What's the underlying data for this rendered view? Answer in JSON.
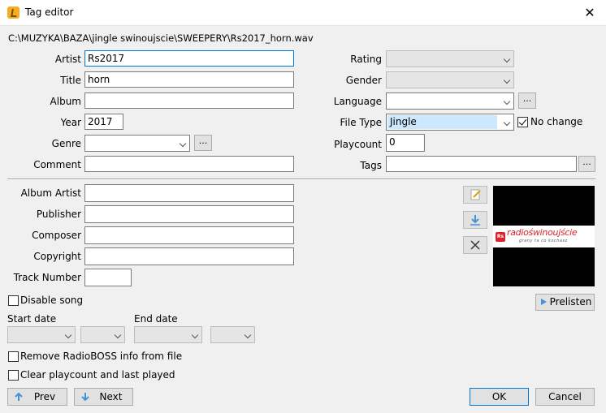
{
  "window": {
    "title": "Tag editor",
    "close_glyph": "✕"
  },
  "file_path": "C:\\MUZYKA\\BAZA\\jingle swinoujscie\\SWEEPERY\\Rs2017_horn.wav",
  "labels": {
    "artist": "Artist",
    "title": "Title",
    "album": "Album",
    "year": "Year",
    "genre": "Genre",
    "comment": "Comment",
    "rating": "Rating",
    "gender": "Gender",
    "language": "Language",
    "file_type": "File Type",
    "playcount": "Playcount",
    "tags": "Tags",
    "album_artist": "Album Artist",
    "publisher": "Publisher",
    "composer": "Composer",
    "copyright": "Copyright",
    "track_number": "Track Number",
    "start_date": "Start date",
    "end_date": "End date"
  },
  "values": {
    "artist": "Rs2017",
    "title": "horn",
    "album": "",
    "year": "2017",
    "genre": "",
    "comment": "",
    "rating": "",
    "gender": "",
    "language": "",
    "file_type": "Jingle",
    "playcount": "0",
    "tags": "",
    "album_artist": "",
    "publisher": "",
    "composer": "",
    "copyright": "",
    "track_number": ""
  },
  "buttons": {
    "ellipsis": "...",
    "prelisten": "Prelisten",
    "prev": "Prev",
    "next": "Next",
    "ok": "OK",
    "cancel": "Cancel"
  },
  "checkboxes": {
    "no_change": {
      "label": "No change",
      "checked": true
    },
    "disable_song": {
      "label": "Disable song",
      "checked": false
    },
    "remove_info": {
      "label": "Remove RadioBOSS info from file",
      "checked": false
    },
    "clear_playcount": {
      "label": "Clear playcount and last played",
      "checked": false
    }
  },
  "cover_art": {
    "brand": "radioświnoujście",
    "tagline": "grany ta co kochasz",
    "badge": "Rs"
  },
  "icons": {
    "edit": "edit-icon",
    "download": "download-icon",
    "delete": "delete-icon",
    "prelisten": "play-icon",
    "prev": "arrow-up-icon",
    "next": "arrow-down-icon"
  },
  "colors": {
    "accent": "#0078d7",
    "selection": "#cce8ff",
    "brand_red": "#d9232d"
  }
}
